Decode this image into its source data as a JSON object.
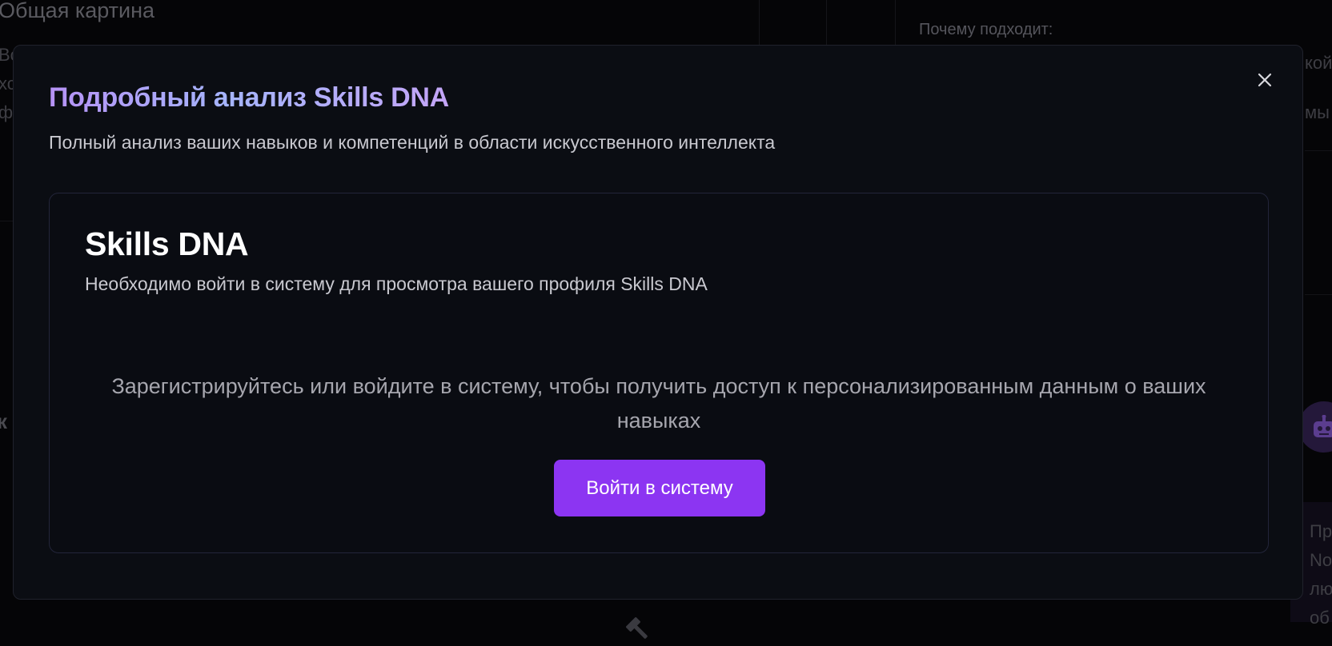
{
  "background": {
    "title": "Общая картина",
    "why_label": "Почему подходит:",
    "fragments": [
      "Вс",
      "хс",
      "фу",
      "кой",
      "мы",
      "к",
      "Пр",
      "No",
      "лю",
      "об"
    ],
    "robot_icon": "robot-icon",
    "gavel_icon": "gavel-icon"
  },
  "modal": {
    "title": "Подробный анализ Skills DNA",
    "subtitle": "Полный анализ ваших навыков и компетенций в области искусственного интеллекта",
    "close_icon": "close-icon",
    "card": {
      "title": "Skills DNA",
      "description": "Необходимо войти в систему для просмотра вашего профиля Skills DNA",
      "message": "Зарегистрируйтесь или войдите в систему, чтобы получить доступ к персонализированным данным о ваших навыках",
      "login_button": "Войти в систему"
    }
  },
  "colors": {
    "accent": "#8c35f2",
    "title_gradient_start": "#b692f6",
    "title_gradient_mid": "#a5b4fc",
    "modal_bg": "#0b0d13"
  }
}
